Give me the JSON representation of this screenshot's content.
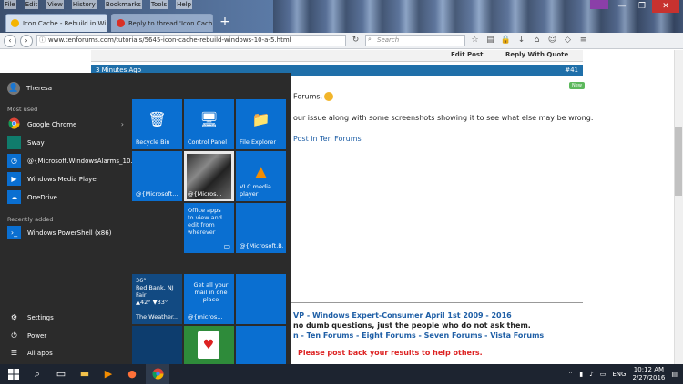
{
  "browser": {
    "menu": [
      "File",
      "Edit",
      "View",
      "History",
      "Bookmarks",
      "Tools",
      "Help"
    ],
    "tabs": [
      {
        "title": "Icon Cache - Rebuild in Wi...",
        "favicon_color": "#f4b400"
      },
      {
        "title": "Reply to thread 'Icon Cache...",
        "favicon_color": "#d93025"
      }
    ],
    "url": "www.tenforums.com/tutorials/5645-icon-cache-rebuild-windows-10-a-5.html",
    "search_placeholder": "Search"
  },
  "post": {
    "actions": [
      "Edit Post",
      "Reply With Quote"
    ],
    "header_time": "3 Minutes Ago",
    "post_number": "#41",
    "new_badge": "New",
    "lines": [
      "Forums.",
      "our issue along with some screenshots showing it to see what else may be wrong.",
      "Post in Ten Forums"
    ],
    "signature": {
      "line1": "VP - Windows Expert-Consumer April 1st 2009 - 2016",
      "line2": "no dumb questions, just the people who do not ask them.",
      "line3": "n - Ten Forums - Eight Forums - Seven Forums - Vista Forums",
      "line4": "Please post back your results to help others."
    }
  },
  "start_menu": {
    "user": "Theresa",
    "most_used_label": "Most used",
    "most_used": [
      {
        "label": "Google Chrome",
        "icon": "chrome-icon",
        "color": "#2b2b2b"
      },
      {
        "label": "Sway",
        "icon": "sway-icon",
        "color": "#107c6c"
      },
      {
        "label": "@{Microsoft.WindowsAlarms_10...",
        "icon": "alarms-icon",
        "color": "#0a6fd1"
      },
      {
        "label": "Windows Media Player",
        "icon": "media-player-icon",
        "color": "#0a6fd1"
      },
      {
        "label": "OneDrive",
        "icon": "onedrive-icon",
        "color": "#0a6fd1"
      }
    ],
    "recently_added_label": "Recently added",
    "recently_added": [
      {
        "label": "Windows PowerShell (x86)",
        "icon": "powershell-icon",
        "color": "#0a6fd1"
      }
    ],
    "bottom": [
      {
        "label": "Settings",
        "icon": "gear-icon"
      },
      {
        "label": "Power",
        "icon": "power-icon"
      },
      {
        "label": "All apps",
        "icon": "all-apps-icon"
      }
    ],
    "tiles": {
      "recycle_bin": "Recycle Bin",
      "control_panel": "Control Panel",
      "file_explorer": "File Explorer",
      "ms1": "@{Microsoft...",
      "photos": "@{Micros...",
      "vlc": "VLC media player",
      "office": "Office apps",
      "office_sub": "to view and edit from wherever",
      "ms_b": "@{Microsoft.B...",
      "weather_temp": "36°",
      "weather_loc": "Red Bank, NJ",
      "weather_cond": "Fair",
      "weather_range": "▲42° ▼33°",
      "weather_name": "The Weather...",
      "mail_text": "Get all your mail in one place",
      "mail_label": "@{micros..."
    }
  },
  "taskbar": {
    "lang": "ENG",
    "time": "10:12 AM",
    "date": "2/27/2016"
  }
}
